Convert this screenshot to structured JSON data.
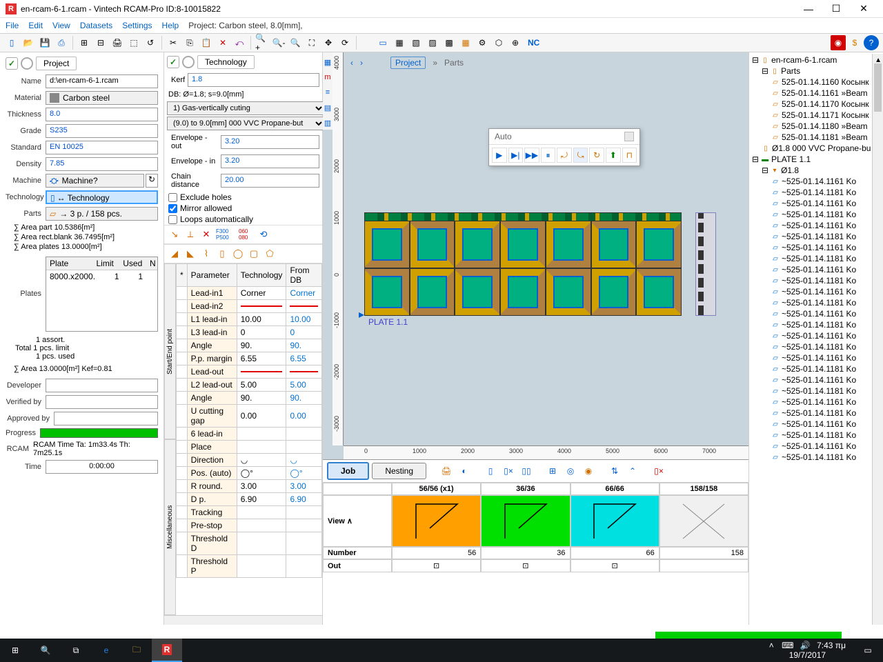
{
  "title": "en-rcam-6-1.rcam - Vintech RCAM-Pro ID:8-10015822",
  "menu": [
    "File",
    "Edit",
    "View",
    "Datasets",
    "Settings",
    "Help",
    "Project: Carbon steel, 8.0[mm],"
  ],
  "project_panel": {
    "title": "Project",
    "name_label": "Name",
    "name": "d:\\en-rcam-6-1.rcam",
    "material_label": "Material",
    "material": "Carbon steel",
    "thickness_label": "Thickness",
    "thickness": "8.0",
    "grade_label": "Grade",
    "grade": "S235",
    "standard_label": "Standard",
    "standard": "EN 10025",
    "density_label": "Density",
    "density": "7.85",
    "machine_label": "Machine",
    "machine": "Machine?",
    "technology_label": "Technology",
    "technology": "↔ Technology",
    "parts_label": "Parts",
    "parts": "→ 3 p. / 158 pcs.",
    "area_part": "∑ Area part 10.5386[m²]",
    "area_blank": "∑ Area rect.blank 36.7495[m²]",
    "area_plates": "∑ Area plates 13.0000[m²]",
    "plates_label": "Plates",
    "plates_cols": [
      "Plate",
      "Limit",
      "Used",
      "N"
    ],
    "plates_rows": [
      [
        "8000.x2000.",
        "1",
        "1",
        ""
      ]
    ],
    "total": {
      "assort": "1 assort.",
      "limit": "Total 1 pcs. limit",
      "used": "1 pcs. used"
    },
    "area_kef": "∑ Area 13.0000[m²] Kef=0.81",
    "developer_label": "Developer",
    "verified_label": "Verified by",
    "approved_label": "Approved by",
    "progress_label": "Progress",
    "rcam": "RCAM Time Ta: 1m33.4s Th: 7m25.1s",
    "time_label": "Time",
    "time": "0:00:00"
  },
  "tech_panel": {
    "title": "Technology",
    "kerf_label": "Kerf",
    "kerf": "1.8",
    "db": "DB: Ø=1.8; s=9.0[mm]",
    "sel1": "1) Gas-vertically cuting",
    "sel2": "(9.0) to 9.0[mm] 000 VVC  Propane-but",
    "env_out_label": "Envelope - out",
    "env_out": "3.20",
    "env_in_label": "Envelope - in",
    "env_in": "3.20",
    "chain_label": "Chain distance",
    "chain": "20.00",
    "exclude": "Exclude holes",
    "mirror": "Mirror allowed",
    "loops": "Loops automatically",
    "table_cols": [
      "*",
      "Parameter",
      "Technology",
      "From DB"
    ],
    "table_rows": [
      [
        "",
        "Lead-in1",
        "Corner",
        "Corner"
      ],
      [
        "",
        "Lead-in2",
        "—",
        "—"
      ],
      [
        "",
        "L1 lead-in",
        "10.00",
        "10.00"
      ],
      [
        "",
        "L3 lead-in",
        "0",
        "0"
      ],
      [
        "",
        "Angle",
        "90.",
        "90."
      ],
      [
        "",
        "P.p. margin",
        "6.55",
        "6.55"
      ],
      [
        "",
        "Lead-out",
        "—",
        "—"
      ],
      [
        "",
        "L2 lead-out",
        "5.00",
        "5.00"
      ],
      [
        "",
        "Angle",
        "90.",
        "90."
      ],
      [
        "",
        "U cutting gap",
        "0.00",
        "0.00"
      ],
      [
        "",
        "6 lead-in",
        "",
        ""
      ],
      [
        "",
        "Place",
        "",
        ""
      ],
      [
        "",
        "Direction",
        "◡",
        "◡"
      ],
      [
        "",
        "Pos. (auto)",
        "◯°",
        "◯°"
      ],
      [
        "",
        "R round.",
        "3.00",
        "3.00"
      ],
      [
        "",
        "D p.",
        "6.90",
        "6.90"
      ],
      [
        "",
        "Tracking",
        "",
        ""
      ],
      [
        "",
        "Pre-stop",
        "",
        ""
      ],
      [
        "",
        "Threshold D",
        "",
        ""
      ],
      [
        "",
        "Threshold P",
        "",
        ""
      ]
    ],
    "vtab1": "Start/End point",
    "vtab2": "Miscellaneous"
  },
  "canvas": {
    "breadcrumb": [
      "Project",
      "»",
      "Parts"
    ],
    "plate_label": "PLATE 1.1",
    "auto": "Auto",
    "ruler_x": [
      "0",
      "1000",
      "2000",
      "3000",
      "4000",
      "5000",
      "6000",
      "7000"
    ],
    "ruler_y": [
      "-3000",
      "-2000",
      "-1000",
      "0",
      "1000",
      "2000",
      "3000",
      "4000"
    ]
  },
  "jobbar": {
    "tabs": [
      "Job",
      "Nesting"
    ],
    "counts": [
      "56/56  (x1)",
      "36/36",
      "66/66",
      "158/158"
    ],
    "rows": [
      "View ∧",
      "Number",
      "Out"
    ],
    "numbers": [
      "56",
      "36",
      "66",
      "158"
    ]
  },
  "tree": {
    "root": "en-rcam-6-1.rcam",
    "parts": "Parts",
    "parts_items": [
      "525-01.14.1160 Косынк",
      "525-01.14.1161 »Beam",
      "525-01.14.1170 Косынк",
      "525-01.14.1171 Косынк",
      "525-01.14.1180 »Beam",
      "525-01.14.1181 »Beam"
    ],
    "tech": "Ø1.8 000 VVC  Propane-bu",
    "plate": "PLATE 1.1",
    "diam": "Ø1.8",
    "nest_items": [
      "~525-01.14.1161 Ko",
      "~525-01.14.1181 Ko",
      "~525-01.14.1161 Ko",
      "~525-01.14.1181 Ko",
      "~525-01.14.1161 Ko",
      "~525-01.14.1181 Ko",
      "~525-01.14.1161 Ko",
      "~525-01.14.1181 Ko",
      "~525-01.14.1161 Ko",
      "~525-01.14.1181 Ko",
      "~525-01.14.1161 Ko",
      "~525-01.14.1181 Ko",
      "~525-01.14.1161 Ko",
      "~525-01.14.1181 Ko",
      "~525-01.14.1161 Ko",
      "~525-01.14.1181 Ko",
      "~525-01.14.1161 Ko",
      "~525-01.14.1181 Ko",
      "~525-01.14.1161 Ko",
      "~525-01.14.1181 Ko",
      "~525-01.14.1161 Ko",
      "~525-01.14.1181 Ko",
      "~525-01.14.1161 Ko",
      "~525-01.14.1181 Ko",
      "~525-01.14.1161 Ko",
      "~525-01.14.1181 Ko"
    ]
  },
  "taskbar": {
    "time": "7:43 πμ",
    "date": "19/7/2017"
  },
  "nc_label": "NC"
}
